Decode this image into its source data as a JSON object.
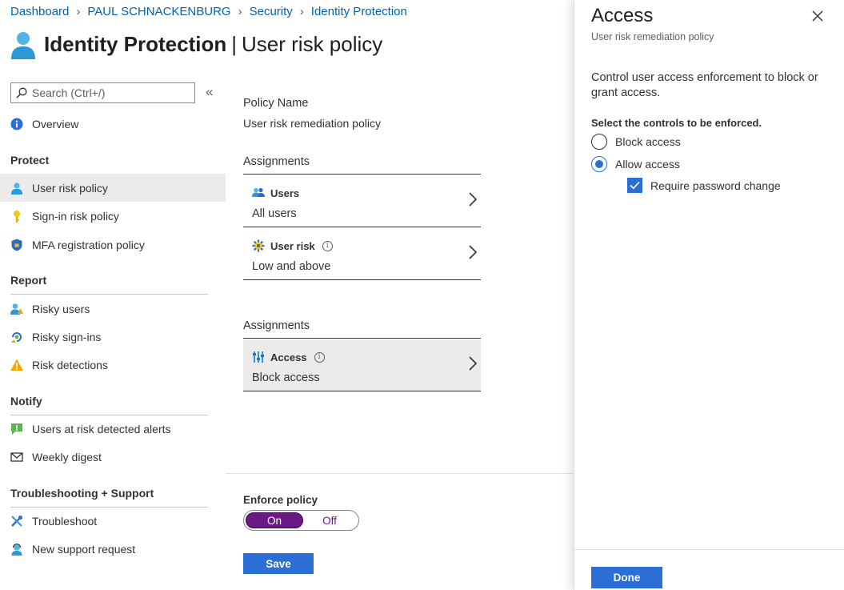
{
  "breadcrumb": [
    "Dashboard",
    "PAUL SCHNACKENBURG",
    "Security",
    "Identity Protection"
  ],
  "header": {
    "title": "Identity Protection",
    "separator": "|",
    "subtitle": "User risk policy"
  },
  "sidebar": {
    "search_placeholder": "Search (Ctrl+/)",
    "collapse_glyph": "«",
    "overview": {
      "label": "Overview",
      "icon": "info-icon"
    },
    "sections": {
      "protect": {
        "title": "Protect",
        "items": [
          {
            "label": "User risk policy",
            "icon": "user-icon",
            "active": true
          },
          {
            "label": "Sign-in risk policy",
            "icon": "key-icon"
          },
          {
            "label": "MFA registration policy",
            "icon": "shield-icon"
          }
        ]
      },
      "report": {
        "title": "Report",
        "items": [
          {
            "label": "Risky users",
            "icon": "risky-user-icon"
          },
          {
            "label": "Risky sign-ins",
            "icon": "risky-signin-icon"
          },
          {
            "label": "Risk detections",
            "icon": "warning-icon"
          }
        ]
      },
      "notify": {
        "title": "Notify",
        "items": [
          {
            "label": "Users at risk detected alerts",
            "icon": "alert-icon"
          },
          {
            "label": "Weekly digest",
            "icon": "mail-icon"
          }
        ]
      },
      "support": {
        "title": "Troubleshooting + Support",
        "items": [
          {
            "label": "Troubleshoot",
            "icon": "tools-icon"
          },
          {
            "label": "New support request",
            "icon": "support-icon"
          }
        ]
      }
    }
  },
  "main": {
    "policy_name_label": "Policy Name",
    "policy_name_value": "User risk remediation policy",
    "assignments_label_1": "Assignments",
    "users_card": {
      "title": "Users",
      "value": "All users"
    },
    "user_risk_card": {
      "title": "User risk",
      "value": "Low and above"
    },
    "assignments_label_2": "Assignments",
    "access_card": {
      "title": "Access",
      "value": "Block access"
    },
    "info_glyph": "i",
    "enforce_label": "Enforce policy",
    "toggle": {
      "on": "On",
      "off": "Off",
      "selected": "On"
    },
    "save_label": "Save"
  },
  "panel": {
    "title": "Access",
    "subtitle": "User risk remediation policy",
    "description": "Control user access enforcement to block or grant access.",
    "controls_label": "Select the controls to be enforced.",
    "block_access": "Block access",
    "allow_access": "Allow access",
    "selected_option": "Allow access",
    "require_password_change": "Require password change",
    "require_password_checked": true,
    "done_label": "Done"
  },
  "colors": {
    "link": "#0063b1",
    "primary": "#2b6ed6",
    "toggle_on": "#6b1a85",
    "active_bg": "#edebe9"
  }
}
